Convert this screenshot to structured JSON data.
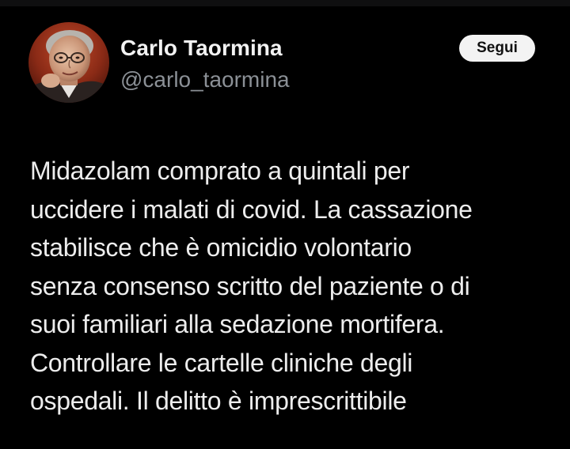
{
  "author": {
    "display_name": "Carlo Taormina",
    "handle": "@carlo_taormina",
    "avatar_icon": "profile-photo"
  },
  "actions": {
    "follow_label": "Segui"
  },
  "tweet": {
    "lines": [
      "Midazolam comprato a quintali per",
      "uccidere i malati di covid. La cassazione",
      "stabilisce che è omicidio volontario",
      "senza consenso scritto del paziente o di",
      "suoi familiari alla sedazione mortifera.",
      "Controllare le cartelle cliniche degli",
      "ospedali. Il delitto è imprescrittibile"
    ]
  },
  "colors": {
    "background": "#000000",
    "text": "#ededed",
    "secondary_text": "#8b9096",
    "button_bg": "#f3f3f3"
  }
}
